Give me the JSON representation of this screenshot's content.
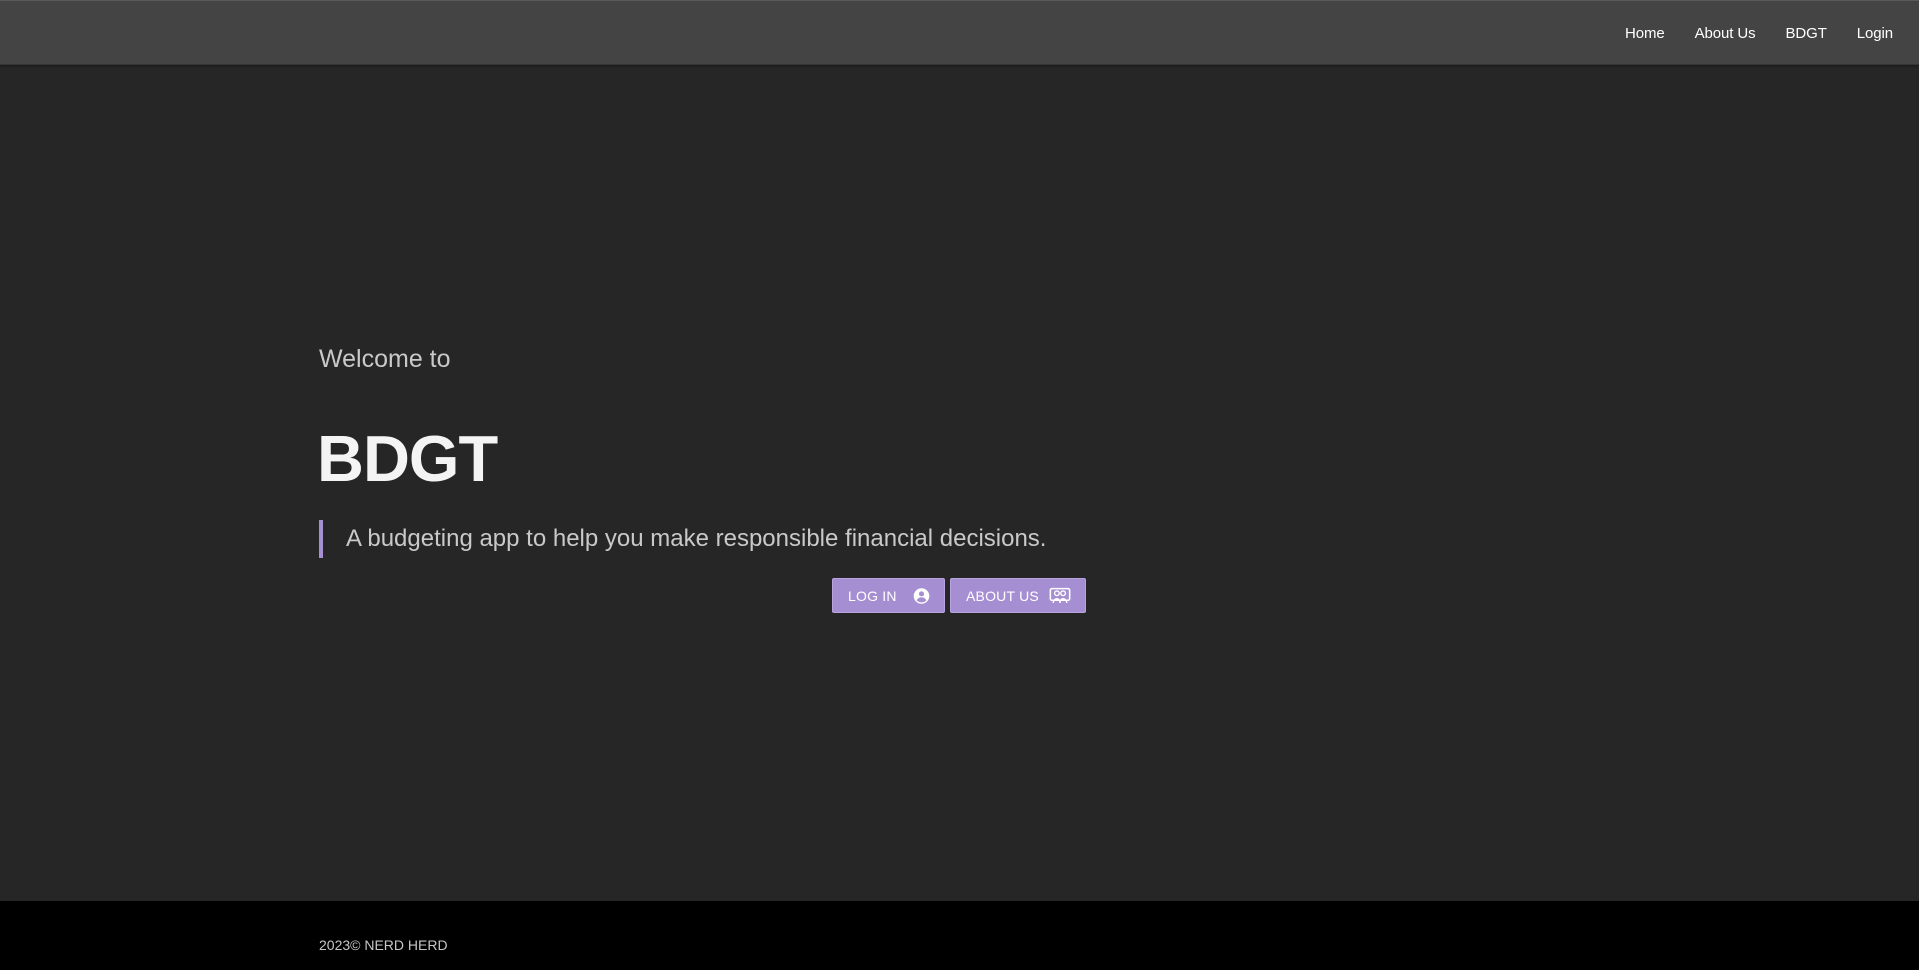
{
  "nav": {
    "links": [
      {
        "label": "Home"
      },
      {
        "label": "About Us"
      },
      {
        "label": "BDGT"
      },
      {
        "label": "Login"
      }
    ]
  },
  "hero": {
    "welcome": "Welcome to",
    "title": "BDGT",
    "tagline": "A budgeting app to help you make responsible financial decisions."
  },
  "buttons": {
    "login": {
      "label": "LOG IN",
      "icon": "account-circle-icon"
    },
    "about": {
      "label": "ABOUT US",
      "icon": "people-card-icon"
    }
  },
  "footer": {
    "copyright": "2023© NERD HERD"
  },
  "colors": {
    "accent": "#a58ed2",
    "background": "#262626",
    "navbar": "#444444",
    "footer": "#000000"
  }
}
